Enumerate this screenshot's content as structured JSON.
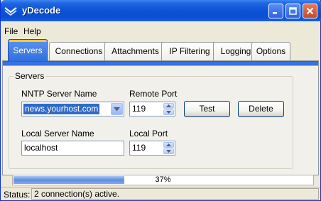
{
  "window": {
    "title": "yDecode"
  },
  "menu": {
    "file": "File",
    "help": "Help"
  },
  "tabs": [
    {
      "label": "Servers",
      "active": true
    },
    {
      "label": "Connections",
      "active": false
    },
    {
      "label": "Attachments",
      "active": false
    },
    {
      "label": "IP Filtering",
      "active": false
    },
    {
      "label": "Logging",
      "active": false
    },
    {
      "label": "Options",
      "active": false
    }
  ],
  "servers": {
    "group_title": "Servers",
    "nntp_label": "NNTP Server Name",
    "nntp_value": "news.yourhost.com",
    "remote_port_label": "Remote Port",
    "remote_port_value": "119",
    "local_label": "Local Server Name",
    "local_value": "localhost",
    "local_port_label": "Local Port",
    "local_port_value": "119",
    "test_button": "Test",
    "delete_button": "Delete"
  },
  "progress": {
    "percent": 37,
    "label": "37%"
  },
  "status": {
    "label": "Status:",
    "text": "2 connection(s) active."
  },
  "colors": {
    "title_bar": "#0a52d8",
    "active_tab": "#2f6fde",
    "selection": "#316ac5"
  }
}
